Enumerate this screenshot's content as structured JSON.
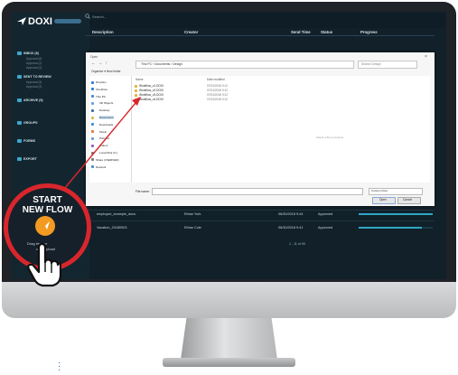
{
  "app": {
    "logo_text": "DOXI",
    "search_placeholder": "Search..."
  },
  "sidebar": {
    "sections": [
      {
        "label": "INBOX (8)",
        "items": [
          "Approval (6)",
          "Approval (2)",
          "Approval (2)"
        ]
      },
      {
        "label": "SENT TO REVIEW",
        "items": [
          "Approval (4)",
          "Approval (2)"
        ]
      },
      {
        "label": "ARCHIVE (9)",
        "items": []
      },
      {
        "label": "GROUPS",
        "items": []
      },
      {
        "label": "FORMS",
        "items": []
      },
      {
        "label": "EXPORT",
        "items": []
      }
    ]
  },
  "table": {
    "headers": [
      "Description",
      "Creator",
      "Send Time",
      "Status",
      "Progress"
    ],
    "rows": [
      {
        "description": "employee_example_docs",
        "creator": "Ethan York",
        "time": "06/30/2018 9:44",
        "status": "Approved",
        "progress": 1.0
      },
      {
        "description": "Vacation_20180903",
        "creator": "Ethan Cole",
        "time": "06/30/2018 9:41",
        "status": "Approved",
        "progress": 0.85
      }
    ],
    "pager": "1 - 11 of 99"
  },
  "dialog": {
    "title": "Open",
    "nav_arrows": "← → ↑",
    "address": "This PC  ›  Documents  ›  Design",
    "search_placeholder": "Search Design",
    "organize": "Organize ▾     New folder",
    "tree": [
      "Dropbox",
      "OneDrive",
      "This PC",
      "3D Objects",
      "Desktop",
      "Documents",
      "Downloads",
      "Music",
      "Pictures",
      "Videos",
      "Local Disk (C:)",
      "Share (\\\\SERVER)",
      "Network"
    ],
    "columns": [
      "Name",
      "Date modified"
    ],
    "files": [
      {
        "name": "Workflow_v1.DOXI",
        "date": "07/04/2018 9:12"
      },
      {
        "name": "Workflow_v2.DOXI",
        "date": "07/04/2018 9:12"
      },
      {
        "name": "Workflow_v3.DOXI",
        "date": "07/04/2018 9:12"
      },
      {
        "name": "Workflow_v4.DOXI",
        "date": "07/04/2018 9:12"
      }
    ],
    "empty_hint": "Select a file to preview.",
    "filename_label": "File name:",
    "filetype": "Custom Files",
    "open_label": "Open",
    "cancel_label": "Cancel"
  },
  "callout": {
    "line1": "START",
    "line2": "NEW FLOW",
    "caption1": "Drag   here or",
    "caption2": "click   upload",
    "ring_color": "#d9262c",
    "rocket_color": "#f29a22"
  }
}
